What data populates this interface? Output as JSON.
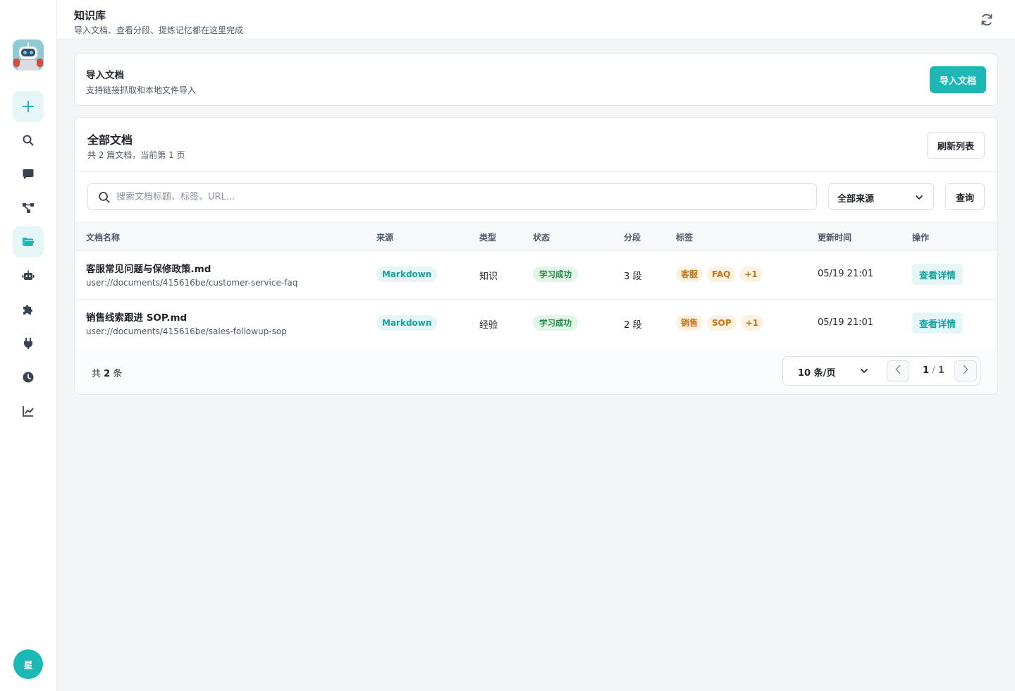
{
  "header": {
    "title": "知识库",
    "subtitle": "导入文档、查看分段、提炼记忆都在这里完成"
  },
  "sidebar": {
    "items": [
      {
        "icon": "plus-icon",
        "active": false,
        "highlight": true
      },
      {
        "icon": "search-icon"
      },
      {
        "icon": "chat-icon"
      },
      {
        "icon": "workflow-icon"
      },
      {
        "icon": "folder-icon",
        "active": true
      },
      {
        "icon": "robot-icon"
      },
      {
        "icon": "puzzle-icon"
      },
      {
        "icon": "plug-icon"
      },
      {
        "icon": "clock-icon"
      },
      {
        "icon": "chart-icon"
      }
    ],
    "avatar_label": "星"
  },
  "import_card": {
    "title": "导入文档",
    "subtitle": "支持链接抓取和本地文件导入",
    "button": "导入文档"
  },
  "list_card": {
    "title": "全部文档",
    "subtitle": "共 2 篇文档，当前第 1 页",
    "refresh_button": "刷新列表",
    "search_placeholder": "搜索文档标题、标签、URL...",
    "source_filter": "全部来源",
    "query_button": "查询",
    "columns": [
      "文档名称",
      "来源",
      "类型",
      "状态",
      "分段",
      "标签",
      "更新时间",
      "操作"
    ],
    "rows": [
      {
        "name": "客服常见问题与保修政策.md",
        "url": "user://documents/415616be/customer-service-faq",
        "source": "Markdown",
        "type": "知识",
        "status": "学习成功",
        "segments": "3 段",
        "tags": [
          "客服",
          "FAQ",
          "+1"
        ],
        "updated": "05/19 21:01",
        "action": "查看详情"
      },
      {
        "name": "销售线索跟进 SOP.md",
        "url": "user://documents/415616be/sales-followup-sop",
        "source": "Markdown",
        "type": "经验",
        "status": "学习成功",
        "segments": "2 段",
        "tags": [
          "销售",
          "SOP",
          "+1"
        ],
        "updated": "05/19 21:01",
        "action": "查看详情"
      }
    ],
    "footer": {
      "total_prefix": "共",
      "total_count": "2",
      "total_suffix": "条",
      "page_size": "10 条/页",
      "current_page": "1",
      "separator": "/",
      "total_pages": "1"
    }
  },
  "colors": {
    "accent": "#1bb8b5",
    "accent_light": "#e6f6f6",
    "success_bg": "#e2f6e8",
    "success_text": "#1e8a46",
    "tag_bg": "#fdf1e0",
    "tag_text": "#c6731a"
  }
}
